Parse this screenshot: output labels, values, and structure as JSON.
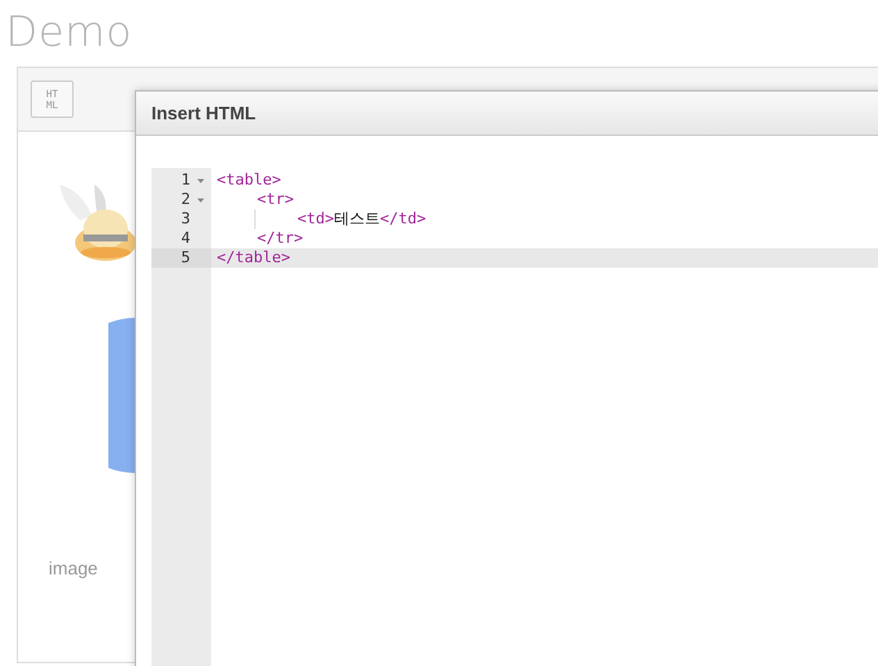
{
  "page_title": "Demo",
  "toolbar": {
    "buttons": [
      {
        "label": "HT\nML"
      }
    ]
  },
  "content": {
    "caption": "image"
  },
  "dialog": {
    "title": "Insert HTML",
    "code_lines": [
      {
        "number": "1",
        "foldable": true,
        "active": false,
        "tokens": [
          {
            "kind": "tag",
            "text": "<table>"
          }
        ],
        "children": [
          {
            "number": "2",
            "foldable": true,
            "active": false,
            "tokens": [
              {
                "kind": "tag",
                "text": "<tr>"
              }
            ],
            "children": [
              {
                "number": "3",
                "foldable": false,
                "active": false,
                "tokens": [
                  {
                    "kind": "tag",
                    "text": "<td>"
                  },
                  {
                    "kind": "text",
                    "text": "테스트"
                  },
                  {
                    "kind": "tag",
                    "text": "</td>"
                  }
                ]
              }
            ]
          },
          {
            "number": "4",
            "foldable": false,
            "active": false,
            "tokens": [
              {
                "kind": "tag",
                "text": "</tr>"
              }
            ]
          }
        ]
      },
      {
        "number": "5",
        "foldable": false,
        "active": true,
        "tokens": [
          {
            "kind": "tag",
            "text": "</table>"
          }
        ]
      }
    ]
  }
}
